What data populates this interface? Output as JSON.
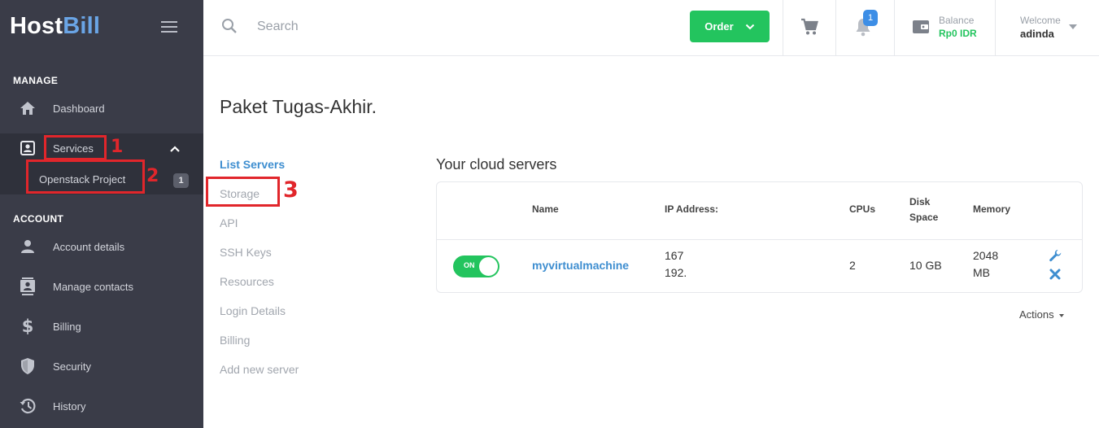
{
  "sidebar": {
    "logo_main": "Host",
    "logo_accent": "Bill",
    "sections": {
      "manage": "MANAGE",
      "account": "ACCOUNT"
    },
    "items": {
      "dashboard": "Dashboard",
      "services": "Services",
      "openstack": "Openstack Project",
      "openstack_count": "1",
      "account_details": "Account details",
      "manage_contacts": "Manage contacts",
      "billing": "Billing",
      "security": "Security",
      "history": "History"
    }
  },
  "annotations": {
    "one": "1",
    "two": "2",
    "three": "3"
  },
  "header": {
    "search_placeholder": "Search",
    "order_label": "Order",
    "notification_count": "1",
    "balance_label": "Balance",
    "balance_value": "Rp0 IDR",
    "welcome_label": "Welcome",
    "username": "adinda"
  },
  "page": {
    "title": "Paket Tugas-Akhir.",
    "subnav": [
      "List Servers",
      "Storage",
      "API",
      "SSH Keys",
      "Resources",
      "Login Details",
      "Billing",
      "Add new server"
    ],
    "cloud_title": "Your cloud servers",
    "table": {
      "headers": {
        "name": "Name",
        "ip": "IP Address:",
        "cpus": "CPUs",
        "disk_l1": "Disk",
        "disk_l2": "Space",
        "memory": "Memory"
      },
      "row": {
        "toggle": "ON",
        "name": "myvirtualmachine",
        "ip_l1": "167",
        "ip_l2": "192.",
        "cpus": "2",
        "disk": "10 GB",
        "mem_l1": "2048",
        "mem_l2": "MB"
      }
    },
    "actions_label": "Actions"
  },
  "colors": {
    "green": "#23c45e",
    "blue": "#3e8ed0",
    "sidebar": "#3a3c48",
    "annotation": "#e1262b"
  }
}
